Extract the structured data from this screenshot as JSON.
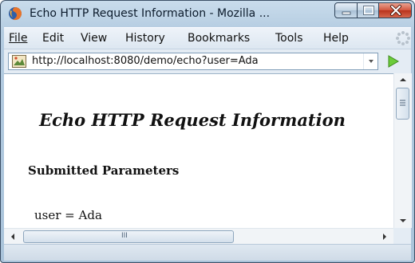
{
  "window": {
    "title": "Echo HTTP Request Information - Mozilla ...",
    "controls": [
      "minimize",
      "maximize",
      "close"
    ]
  },
  "menu": {
    "items": [
      "File",
      "Edit",
      "View",
      "History",
      "Bookmarks",
      "Tools",
      "Help"
    ]
  },
  "navigation": {
    "url": "http://localhost:8080/demo/echo?user=Ada"
  },
  "page": {
    "title": "Echo HTTP Request Information",
    "section_heading": "Submitted Parameters",
    "parameters": [
      {
        "text": "user = Ada"
      }
    ]
  },
  "icons": {
    "app": "firefox-logo-icon",
    "site": "site-favicon-icon",
    "go": "go-arrow-icon",
    "throbber": "throbber-icon",
    "dropdown": "chevron-down-icon"
  },
  "scrollbar_grip": "III"
}
